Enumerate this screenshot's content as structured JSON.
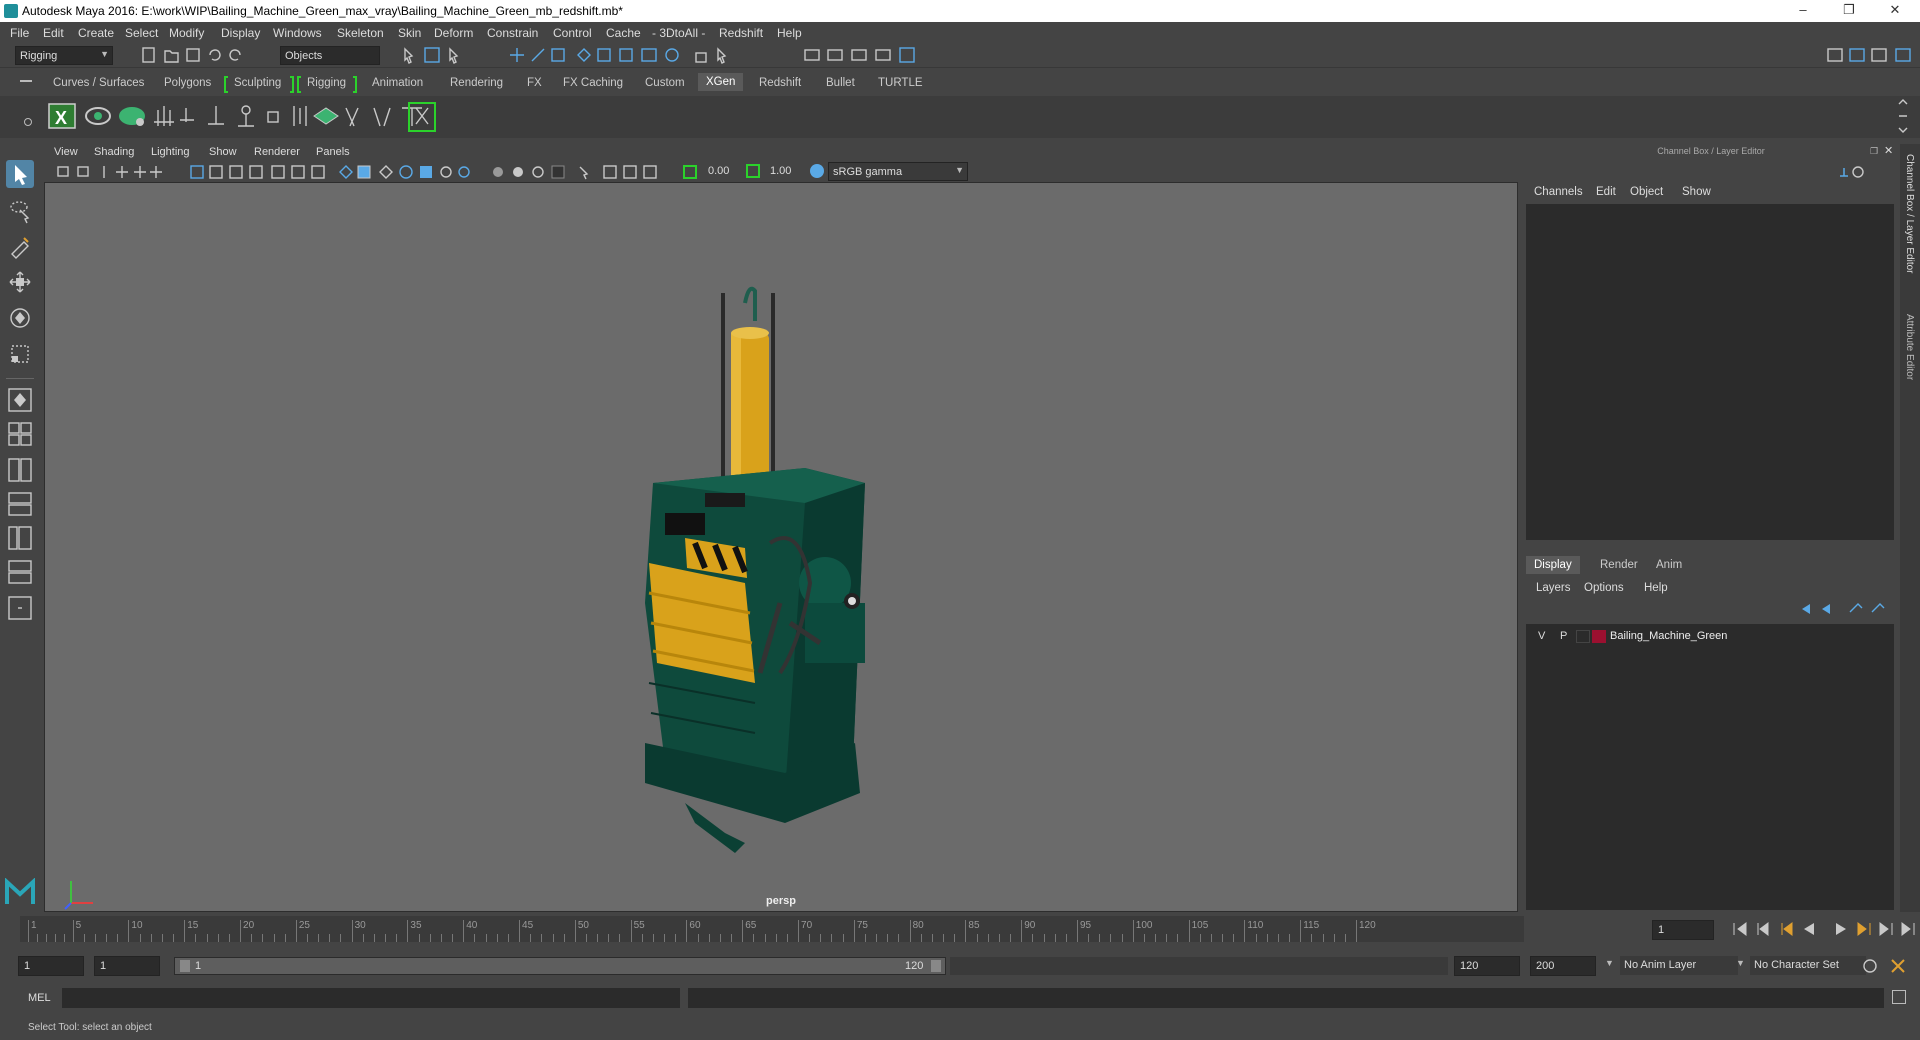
{
  "window": {
    "title": "Autodesk Maya 2016: E:\\work\\WIP\\Bailing_Machine_Green_max_vray\\Bailing_Machine_Green_mb_redshift.mb*"
  },
  "menus": [
    "File",
    "Edit",
    "Create",
    "Select",
    "Modify",
    "Display",
    "Windows",
    "Skeleton",
    "Skin",
    "Deform",
    "Constrain",
    "Control",
    "Cache",
    "- 3DtoAll -",
    "Redshift",
    "Help"
  ],
  "status": {
    "mode": "Rigging",
    "selection_mask": "Objects"
  },
  "shelf_tabs": [
    "Curves / Surfaces",
    "Polygons",
    "Sculpting",
    "Rigging",
    "Animation",
    "Rendering",
    "FX",
    "FX Caching",
    "Custom",
    "XGen",
    "Redshift",
    "Bullet",
    "TURTLE"
  ],
  "shelf_active": "XGen",
  "panel_menus": [
    "View",
    "Shading",
    "Lighting",
    "Show",
    "Renderer",
    "Panels"
  ],
  "viewbar": {
    "exposure": "0.00",
    "gamma": "1.00",
    "color_space": "sRGB gamma"
  },
  "viewport": {
    "camera": "persp"
  },
  "channel_box": {
    "title": "Channel Box / Layer Editor",
    "menus": [
      "Channels",
      "Edit",
      "Object",
      "Show"
    ]
  },
  "layer_editor": {
    "tabs": [
      "Display",
      "Render",
      "Anim"
    ],
    "active_tab": "Display",
    "menus": [
      "Layers",
      "Options",
      "Help"
    ],
    "layers": [
      {
        "v": "V",
        "p": "P",
        "name": "Bailing_Machine_Green",
        "color": "#9b1030"
      }
    ]
  },
  "side_tabs": [
    "Channel Box / Layer Editor",
    "Attribute Editor"
  ],
  "timeline": {
    "ticks": [
      "1",
      "5",
      "10",
      "15",
      "20",
      "25",
      "30",
      "35",
      "40",
      "45",
      "50",
      "55",
      "60",
      "65",
      "70",
      "75",
      "80",
      "85",
      "90",
      "95",
      "100",
      "105",
      "110",
      "115",
      "120"
    ],
    "current_frame": "1"
  },
  "range": {
    "start": "1",
    "playback_start": "1",
    "slider_start": "1",
    "slider_end": "120",
    "playback_end": "120",
    "end": "200",
    "anim_layer": "No Anim Layer",
    "char_set": "No Character Set"
  },
  "mel": {
    "label": "MEL"
  },
  "help": {
    "text": "Select Tool: select an object"
  },
  "colors": {
    "machine_green": "#0e4a3c",
    "cylinder_yellow": "#d9a21b"
  }
}
